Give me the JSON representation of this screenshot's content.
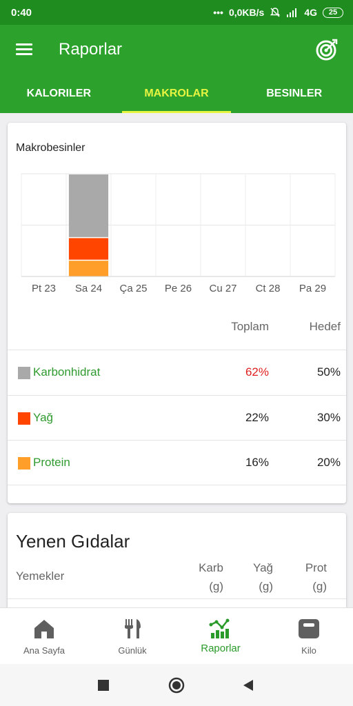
{
  "status_bar": {
    "time": "0:40",
    "dots": "•••",
    "speed": "0,0KB/s",
    "network": "4G",
    "battery": "25"
  },
  "app_bar": {
    "title": "Raporlar",
    "menu_icon": "hamburger-menu-icon",
    "goal_icon": "target-icon"
  },
  "tabs": [
    {
      "label": "KALORILER",
      "active": false
    },
    {
      "label": "MAKROLAR",
      "active": true
    },
    {
      "label": "BESINLER",
      "active": false
    }
  ],
  "macros_card": {
    "title": "Makrobesinler",
    "header_total": "Toplam",
    "header_goal": "Hedef",
    "rows": [
      {
        "name": "Karbonhidrat",
        "total": "62%",
        "goal": "50%",
        "color": "#a9a9a9",
        "over": true
      },
      {
        "name": "Yağ",
        "total": "22%",
        "goal": "30%",
        "color": "#ff4500",
        "over": false
      },
      {
        "name": "Protein",
        "total": "16%",
        "goal": "20%",
        "color": "#ff9f2a",
        "over": false
      }
    ]
  },
  "chart_data": {
    "type": "bar",
    "stacked": true,
    "categories": [
      "Pt 23",
      "Sa 24",
      "Ça 25",
      "Pe 26",
      "Cu 27",
      "Ct 28",
      "Pa 29"
    ],
    "series": [
      {
        "name": "Protein",
        "color": "#ff9f2a",
        "values": [
          0,
          16,
          0,
          0,
          0,
          0,
          0
        ]
      },
      {
        "name": "Yağ",
        "color": "#ff4500",
        "values": [
          0,
          22,
          0,
          0,
          0,
          0,
          0
        ]
      },
      {
        "name": "Karbonhidrat",
        "color": "#a9a9a9",
        "values": [
          0,
          62,
          0,
          0,
          0,
          0,
          0
        ]
      }
    ],
    "ylim": [
      0,
      100
    ],
    "grid": true
  },
  "foods_card": {
    "title": "Yenen Gıdalar",
    "col_meals": "Yemekler",
    "col_carb": "Karb",
    "col_fat": "Yağ",
    "col_prot": "Prot",
    "unit": "(g)"
  },
  "bottom_nav": [
    {
      "label": "Ana Sayfa",
      "icon": "home-icon",
      "active": false
    },
    {
      "label": "Günlük",
      "icon": "fork-knife-icon",
      "active": false
    },
    {
      "label": "Raporlar",
      "icon": "chart-icon",
      "active": true
    },
    {
      "label": "Kilo",
      "icon": "scale-icon",
      "active": false
    }
  ],
  "colors": {
    "status_bar": "#1e8c1e",
    "primary": "#2ca12c",
    "tab_active": "#e7f542",
    "over_goal": "#e02020"
  }
}
